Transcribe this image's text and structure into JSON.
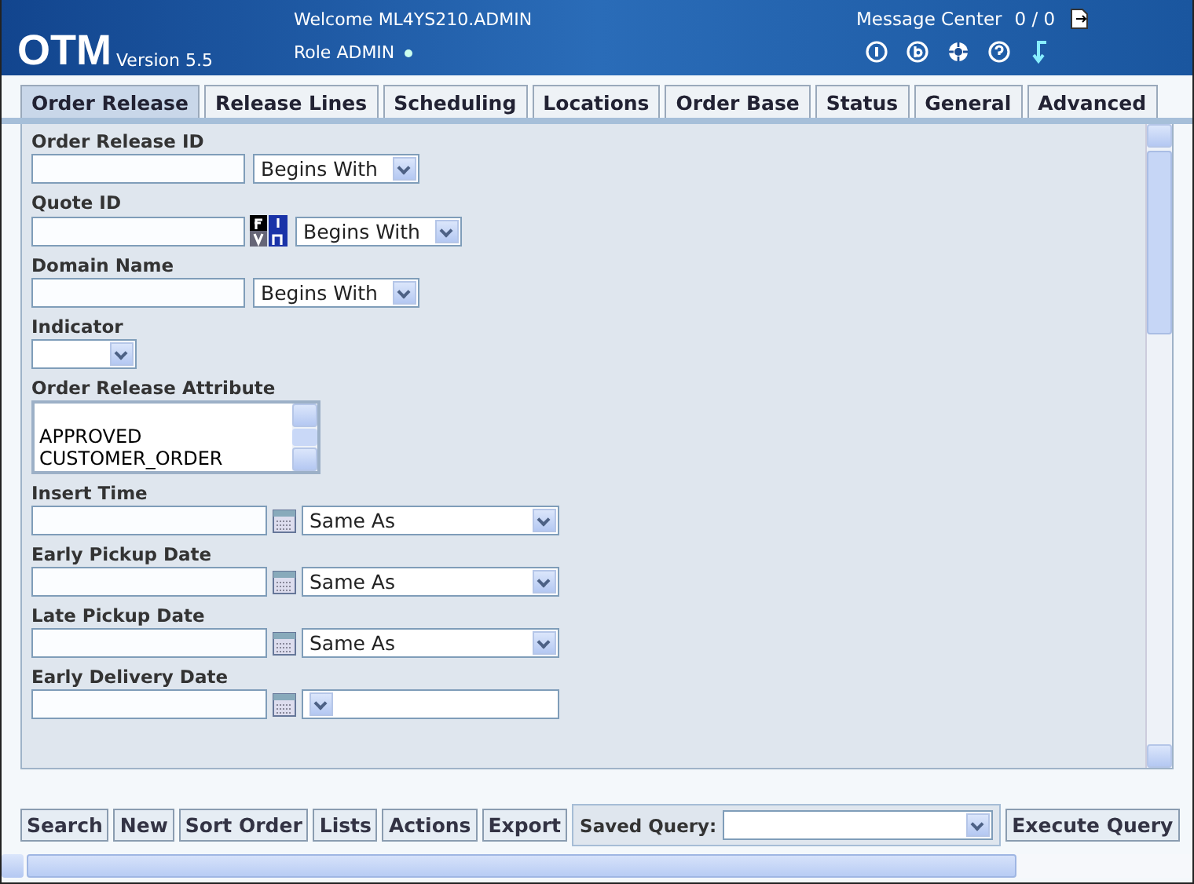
{
  "header": {
    "logo": "OTM",
    "version": "Version 5.5",
    "welcome": "Welcome ML4YS210.ADMIN",
    "role": "Role ADMIN",
    "message_center": "Message Center",
    "message_count": "0 / 0"
  },
  "tabs": [
    {
      "label": "Order Release",
      "selected": true
    },
    {
      "label": "Release Lines",
      "selected": false
    },
    {
      "label": "Scheduling",
      "selected": false
    },
    {
      "label": "Locations",
      "selected": false
    },
    {
      "label": "Order Base",
      "selected": false
    },
    {
      "label": "Status",
      "selected": false
    },
    {
      "label": "General",
      "selected": false
    },
    {
      "label": "Advanced",
      "selected": false
    }
  ],
  "fields": [
    {
      "kind": "text",
      "label": "Order Release ID",
      "operator": "Begins With"
    },
    {
      "kind": "lookup",
      "label": "Quote ID",
      "operator": "Begins With"
    },
    {
      "kind": "text",
      "label": "Domain Name",
      "operator": "Begins With"
    },
    {
      "kind": "select",
      "label": "Indicator"
    },
    {
      "kind": "list",
      "label": "Order Release Attribute",
      "options": [
        "APPROVED",
        "CUSTOMER_ORDER"
      ]
    },
    {
      "kind": "date",
      "label": "Insert Time",
      "operator": "Same As"
    },
    {
      "kind": "date",
      "label": "Early Pickup Date",
      "operator": "Same As"
    },
    {
      "kind": "date",
      "label": "Late Pickup Date",
      "operator": "Same As"
    },
    {
      "kind": "date",
      "label": "Early Delivery Date"
    }
  ],
  "buttons": [
    "Search",
    "New",
    "Sort Order",
    "Lists",
    "Actions",
    "Export"
  ],
  "saved_query": {
    "label": "Saved Query:"
  },
  "execute_button": "Execute Query"
}
